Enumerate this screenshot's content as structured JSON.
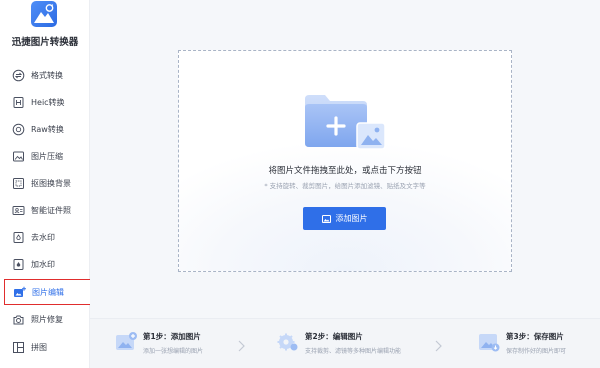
{
  "app": {
    "name": "迅捷图片转换器"
  },
  "sidebar": {
    "items": [
      {
        "label": "格式转换",
        "icon": "format-convert-icon"
      },
      {
        "label": "Heic转换",
        "icon": "heic-icon"
      },
      {
        "label": "Raw转换",
        "icon": "raw-icon"
      },
      {
        "label": "图片压缩",
        "icon": "compress-icon"
      },
      {
        "label": "抠图换背景",
        "icon": "cutout-icon"
      },
      {
        "label": "智能证件照",
        "icon": "id-photo-icon"
      },
      {
        "label": "去水印",
        "icon": "remove-watermark-icon"
      },
      {
        "label": "加水印",
        "icon": "add-watermark-icon"
      },
      {
        "label": "图片编辑",
        "icon": "image-edit-icon",
        "active": true
      },
      {
        "label": "照片修复",
        "icon": "photo-repair-icon"
      },
      {
        "label": "拼图",
        "icon": "collage-icon"
      }
    ]
  },
  "dropzone": {
    "title": "将图片文件拖拽至此处，或点击下方按钮",
    "subtitle": "* 支持旋转、裁剪图片，给图片添加滤镜、贴纸及文字等",
    "button_label": "添加图片"
  },
  "steps": [
    {
      "title": "第1步：添加图片",
      "desc": "添加一张想编辑的图片"
    },
    {
      "title": "第2步：编辑图片",
      "desc": "支持裁剪、滤镜等多种图片编辑功能"
    },
    {
      "title": "第3步：保存图片",
      "desc": "保存制作好的图片即可"
    }
  ],
  "colors": {
    "accent": "#2f6fe8",
    "highlight_border": "#e02d2d"
  }
}
